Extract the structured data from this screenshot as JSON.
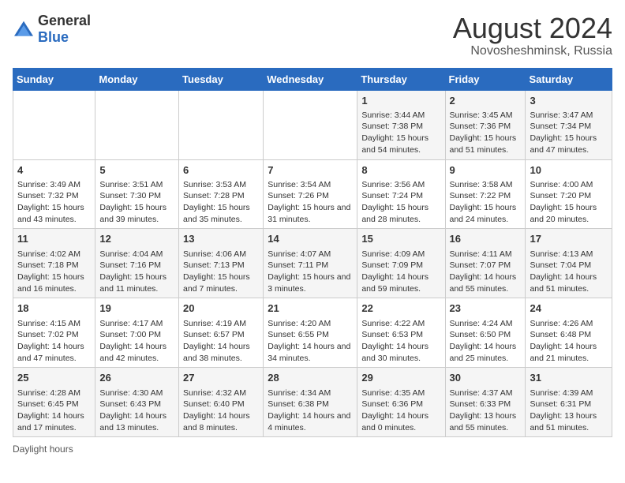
{
  "logo": {
    "general": "General",
    "blue": "Blue"
  },
  "title": "August 2024",
  "subtitle": "Novosheshminsk, Russia",
  "days_of_week": [
    "Sunday",
    "Monday",
    "Tuesday",
    "Wednesday",
    "Thursday",
    "Friday",
    "Saturday"
  ],
  "footer": "Daylight hours",
  "weeks": [
    [
      {
        "day": "",
        "info": ""
      },
      {
        "day": "",
        "info": ""
      },
      {
        "day": "",
        "info": ""
      },
      {
        "day": "",
        "info": ""
      },
      {
        "day": "1",
        "info": "Sunrise: 3:44 AM\nSunset: 7:38 PM\nDaylight: 15 hours and 54 minutes."
      },
      {
        "day": "2",
        "info": "Sunrise: 3:45 AM\nSunset: 7:36 PM\nDaylight: 15 hours and 51 minutes."
      },
      {
        "day": "3",
        "info": "Sunrise: 3:47 AM\nSunset: 7:34 PM\nDaylight: 15 hours and 47 minutes."
      }
    ],
    [
      {
        "day": "4",
        "info": "Sunrise: 3:49 AM\nSunset: 7:32 PM\nDaylight: 15 hours and 43 minutes."
      },
      {
        "day": "5",
        "info": "Sunrise: 3:51 AM\nSunset: 7:30 PM\nDaylight: 15 hours and 39 minutes."
      },
      {
        "day": "6",
        "info": "Sunrise: 3:53 AM\nSunset: 7:28 PM\nDaylight: 15 hours and 35 minutes."
      },
      {
        "day": "7",
        "info": "Sunrise: 3:54 AM\nSunset: 7:26 PM\nDaylight: 15 hours and 31 minutes."
      },
      {
        "day": "8",
        "info": "Sunrise: 3:56 AM\nSunset: 7:24 PM\nDaylight: 15 hours and 28 minutes."
      },
      {
        "day": "9",
        "info": "Sunrise: 3:58 AM\nSunset: 7:22 PM\nDaylight: 15 hours and 24 minutes."
      },
      {
        "day": "10",
        "info": "Sunrise: 4:00 AM\nSunset: 7:20 PM\nDaylight: 15 hours and 20 minutes."
      }
    ],
    [
      {
        "day": "11",
        "info": "Sunrise: 4:02 AM\nSunset: 7:18 PM\nDaylight: 15 hours and 16 minutes."
      },
      {
        "day": "12",
        "info": "Sunrise: 4:04 AM\nSunset: 7:16 PM\nDaylight: 15 hours and 11 minutes."
      },
      {
        "day": "13",
        "info": "Sunrise: 4:06 AM\nSunset: 7:13 PM\nDaylight: 15 hours and 7 minutes."
      },
      {
        "day": "14",
        "info": "Sunrise: 4:07 AM\nSunset: 7:11 PM\nDaylight: 15 hours and 3 minutes."
      },
      {
        "day": "15",
        "info": "Sunrise: 4:09 AM\nSunset: 7:09 PM\nDaylight: 14 hours and 59 minutes."
      },
      {
        "day": "16",
        "info": "Sunrise: 4:11 AM\nSunset: 7:07 PM\nDaylight: 14 hours and 55 minutes."
      },
      {
        "day": "17",
        "info": "Sunrise: 4:13 AM\nSunset: 7:04 PM\nDaylight: 14 hours and 51 minutes."
      }
    ],
    [
      {
        "day": "18",
        "info": "Sunrise: 4:15 AM\nSunset: 7:02 PM\nDaylight: 14 hours and 47 minutes."
      },
      {
        "day": "19",
        "info": "Sunrise: 4:17 AM\nSunset: 7:00 PM\nDaylight: 14 hours and 42 minutes."
      },
      {
        "day": "20",
        "info": "Sunrise: 4:19 AM\nSunset: 6:57 PM\nDaylight: 14 hours and 38 minutes."
      },
      {
        "day": "21",
        "info": "Sunrise: 4:20 AM\nSunset: 6:55 PM\nDaylight: 14 hours and 34 minutes."
      },
      {
        "day": "22",
        "info": "Sunrise: 4:22 AM\nSunset: 6:53 PM\nDaylight: 14 hours and 30 minutes."
      },
      {
        "day": "23",
        "info": "Sunrise: 4:24 AM\nSunset: 6:50 PM\nDaylight: 14 hours and 25 minutes."
      },
      {
        "day": "24",
        "info": "Sunrise: 4:26 AM\nSunset: 6:48 PM\nDaylight: 14 hours and 21 minutes."
      }
    ],
    [
      {
        "day": "25",
        "info": "Sunrise: 4:28 AM\nSunset: 6:45 PM\nDaylight: 14 hours and 17 minutes."
      },
      {
        "day": "26",
        "info": "Sunrise: 4:30 AM\nSunset: 6:43 PM\nDaylight: 14 hours and 13 minutes."
      },
      {
        "day": "27",
        "info": "Sunrise: 4:32 AM\nSunset: 6:40 PM\nDaylight: 14 hours and 8 minutes."
      },
      {
        "day": "28",
        "info": "Sunrise: 4:34 AM\nSunset: 6:38 PM\nDaylight: 14 hours and 4 minutes."
      },
      {
        "day": "29",
        "info": "Sunrise: 4:35 AM\nSunset: 6:36 PM\nDaylight: 14 hours and 0 minutes."
      },
      {
        "day": "30",
        "info": "Sunrise: 4:37 AM\nSunset: 6:33 PM\nDaylight: 13 hours and 55 minutes."
      },
      {
        "day": "31",
        "info": "Sunrise: 4:39 AM\nSunset: 6:31 PM\nDaylight: 13 hours and 51 minutes."
      }
    ]
  ]
}
